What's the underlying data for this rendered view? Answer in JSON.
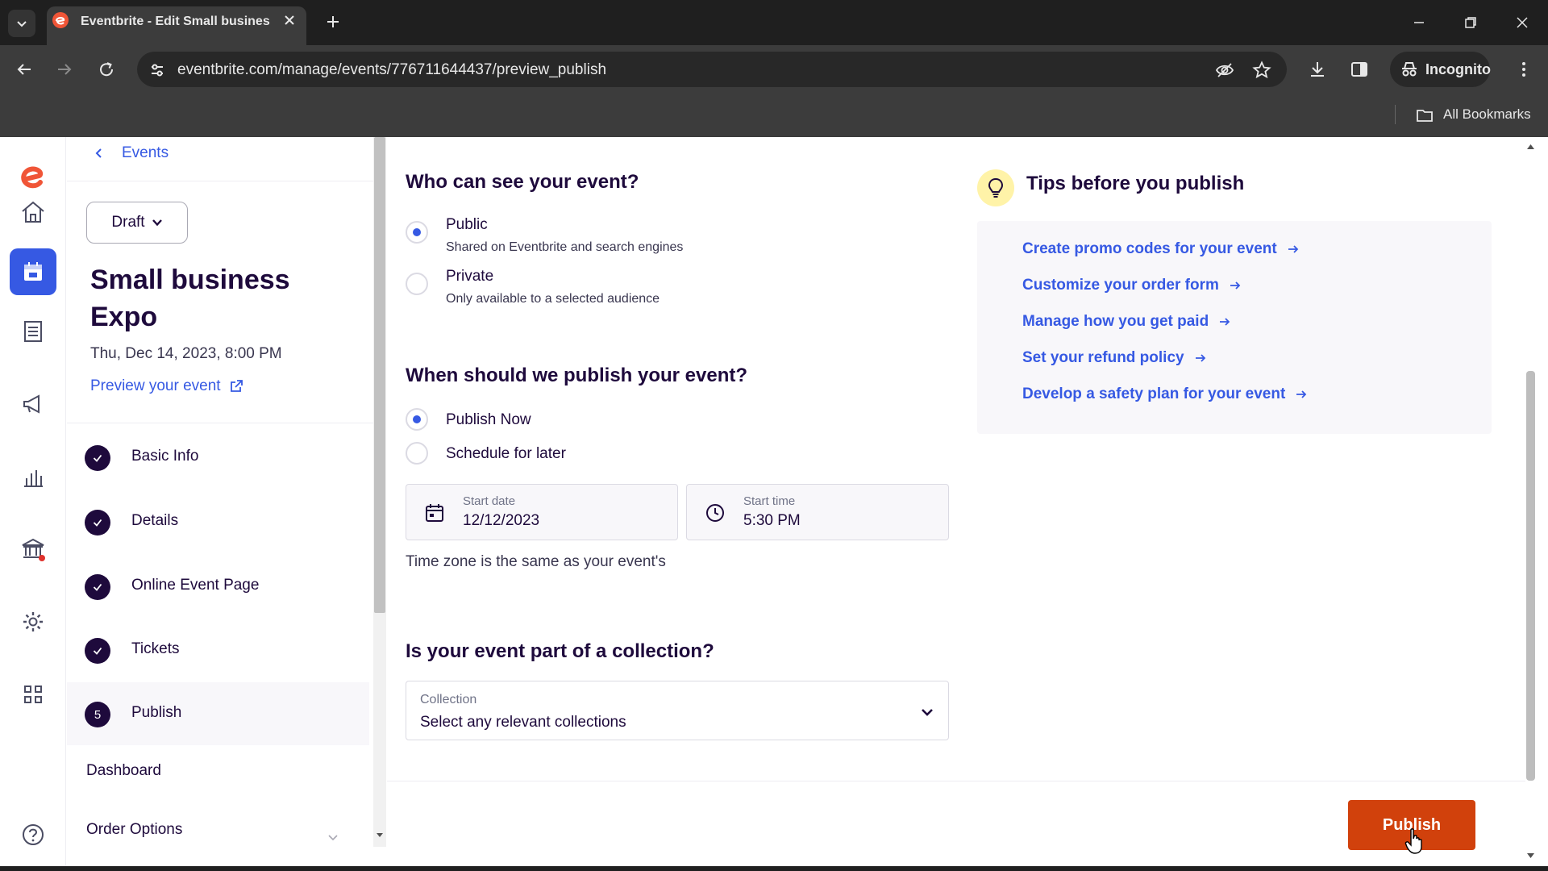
{
  "browser": {
    "tab_title": "Eventbrite - Edit Small busines",
    "url": "eventbrite.com/manage/events/776711644437/preview_publish",
    "incognito_label": "Incognito",
    "bookmarks_label": "All Bookmarks"
  },
  "sidebar": {
    "back_label": "Events",
    "status_label": "Draft",
    "event_title": "Small business Expo",
    "event_date": "Thu, Dec 14, 2023, 8:00 PM",
    "preview_label": "Preview your event",
    "steps": [
      {
        "label": "Basic Info",
        "state": "complete"
      },
      {
        "label": "Details",
        "state": "complete"
      },
      {
        "label": "Online Event Page",
        "state": "complete"
      },
      {
        "label": "Tickets",
        "state": "complete"
      },
      {
        "label": "Publish",
        "state": "current",
        "number": "5"
      }
    ],
    "dashboard_label": "Dashboard",
    "order_options_label": "Order Options"
  },
  "visibility": {
    "title": "Who can see your event?",
    "options": [
      {
        "label": "Public",
        "description": "Shared on Eventbrite and search engines",
        "selected": true
      },
      {
        "label": "Private",
        "description": "Only available to a selected audience",
        "selected": false
      }
    ]
  },
  "publish_timing": {
    "title": "When should we publish your event?",
    "options": [
      {
        "label": "Publish Now",
        "selected": true
      },
      {
        "label": "Schedule for later",
        "selected": false
      }
    ],
    "start_date_label": "Start date",
    "start_date_value": "12/12/2023",
    "start_time_label": "Start time",
    "start_time_value": "5:30 PM",
    "timezone_note": "Time zone is the same as your event's"
  },
  "collection": {
    "title": "Is your event part of a collection?",
    "field_label": "Collection",
    "placeholder": "Select any relevant collections"
  },
  "tips": {
    "title": "Tips before you publish",
    "links": [
      "Create promo codes for your event",
      "Customize your order form",
      "Manage how you get paid",
      "Set your refund policy",
      "Develop a safety plan for your event"
    ]
  },
  "footer": {
    "publish_label": "Publish"
  },
  "colors": {
    "brand_orange": "#d1410c",
    "link_blue": "#3659e3",
    "text_dark": "#1e0a3c"
  }
}
